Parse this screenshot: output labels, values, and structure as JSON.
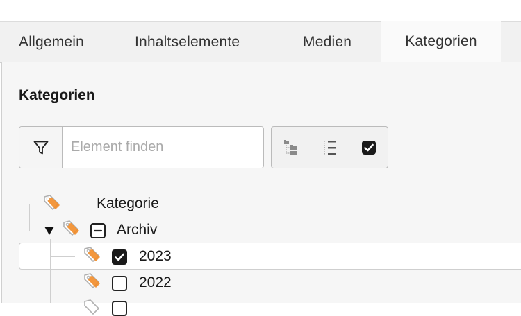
{
  "tabs": [
    {
      "label": "Allgemein"
    },
    {
      "label": "Inhaltselemente"
    },
    {
      "label": "Medien"
    },
    {
      "label": "Kategorien",
      "active": true
    }
  ],
  "section": {
    "title": "Kategorien"
  },
  "filter": {
    "placeholder": "Element finden",
    "value": ""
  },
  "toolbar_buttons": [
    {
      "icon": "collapse-tree-icon"
    },
    {
      "icon": "expand-list-icon"
    },
    {
      "icon": "checkbox-toggle-icon"
    }
  ],
  "tree": {
    "root": {
      "label": "Kategorie",
      "icon": "category-tag-icon"
    },
    "items": [
      {
        "label": "Archiv",
        "state": "partial",
        "expanded": true
      },
      {
        "label": "2023",
        "state": "checked"
      },
      {
        "label": "2022",
        "state": "unchecked"
      }
    ]
  },
  "colors": {
    "tag_orange": "#f28c28",
    "tag_outline": "#b0b0b0",
    "checkbox_dark": "#1a1a1a",
    "panel_bg": "#f6f6f6",
    "tabbar_bg": "#f1f1f1"
  }
}
